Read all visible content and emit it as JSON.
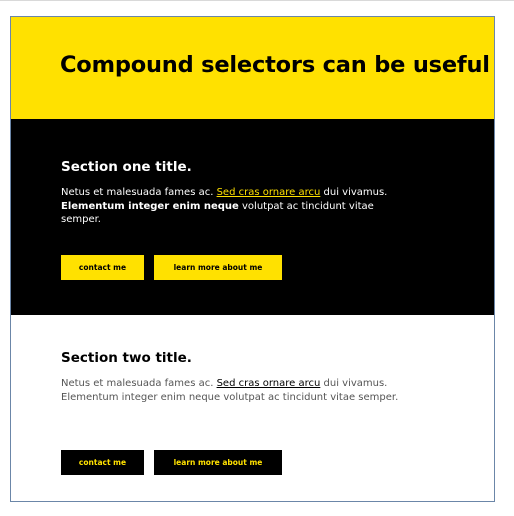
{
  "hero": {
    "title": "Compound selectors can be useful"
  },
  "section_one": {
    "title": "Section one title.",
    "text_start": "Netus et malesuada fames ac. ",
    "link": "Sed cras ornare arcu",
    "text_mid": " dui vivamus. ",
    "bold": "Elementum integer enim neque",
    "text_end": " volutpat ac tincidunt vitae semper.",
    "contact_label": "contact me",
    "learn_label": "learn more about me"
  },
  "section_two": {
    "title": "Section two title.",
    "text_start": "Netus et malesuada fames ac. ",
    "link": "Sed cras ornare arcu",
    "text_mid": " dui vivamus. ",
    "plain": "Elementum integer enim neque",
    "text_end": " volutpat ac tincidunt vitae semper.",
    "contact_label": "contact me",
    "learn_label": "learn more about me"
  },
  "colors": {
    "accent": "#ffe100",
    "dark": "#000000",
    "light": "#ffffff"
  }
}
